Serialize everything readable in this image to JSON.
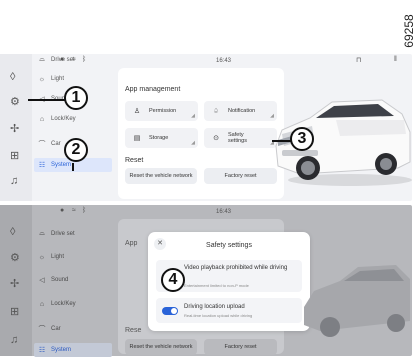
{
  "figure_code": "69258",
  "status_bar": {
    "time": "16:43",
    "icons": [
      "profile-icon",
      "wifi-icon",
      "bluetooth-icon",
      "lock-icon",
      "notification-icon"
    ]
  },
  "rail_icons": [
    "home-icon",
    "settings-icon",
    "fan-icon",
    "apps-icon",
    "music-icon"
  ],
  "menu": {
    "items": [
      {
        "label": "Drive set",
        "icon": "car-icon"
      },
      {
        "label": "Light",
        "icon": "light-icon"
      },
      {
        "label": "Sound",
        "icon": "sound-icon"
      },
      {
        "label": "Lock/Key",
        "icon": "lock-icon"
      },
      {
        "label": "Car",
        "icon": "car-side-icon"
      },
      {
        "label": "System",
        "icon": "system-icon"
      }
    ],
    "active": "System"
  },
  "app_management": {
    "title": "App management",
    "tiles": [
      {
        "label": "Permission",
        "icon": "person-icon"
      },
      {
        "label": "Notification",
        "icon": "bell-icon"
      },
      {
        "label": "Storage",
        "icon": "storage-icon"
      },
      {
        "label": "Safety settings",
        "icon": "shield-icon"
      }
    ]
  },
  "reset": {
    "title": "Reset",
    "buttons": [
      "Reset the vehicle network",
      "Factory reset"
    ]
  },
  "dialog": {
    "title": "Safety settings",
    "rows": [
      {
        "title": "Video playback prohibited while driving",
        "subtitle": "Entertainment limited to non-P mode",
        "enabled": false
      },
      {
        "title": "Driving location upload",
        "subtitle": "Real-time location upload while driving",
        "enabled": true
      }
    ]
  },
  "callouts": [
    "1",
    "2",
    "3",
    "4"
  ],
  "colors": {
    "accent": "#2a63d8",
    "panel": "#f2f3f6",
    "overlay": "#b7b8bc"
  }
}
